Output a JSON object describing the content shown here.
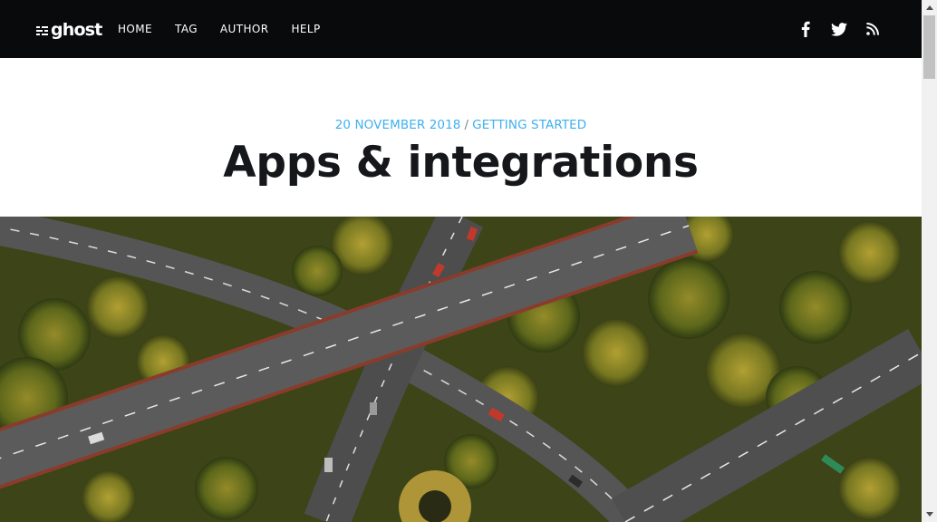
{
  "navbar": {
    "logo_text": "ghost",
    "links": [
      {
        "label": "HOME"
      },
      {
        "label": "TAG"
      },
      {
        "label": "AUTHOR"
      },
      {
        "label": "HELP"
      }
    ],
    "social_icons": [
      "facebook-icon",
      "twitter-icon",
      "rss-icon"
    ]
  },
  "post": {
    "date": "20 NOVEMBER 2018",
    "separator": "/",
    "tag": "GETTING STARTED",
    "title": "Apps & integrations"
  },
  "colors": {
    "navbar_bg": "#090a0b",
    "accent_blue": "#3eb0ef",
    "title": "#15171a"
  }
}
